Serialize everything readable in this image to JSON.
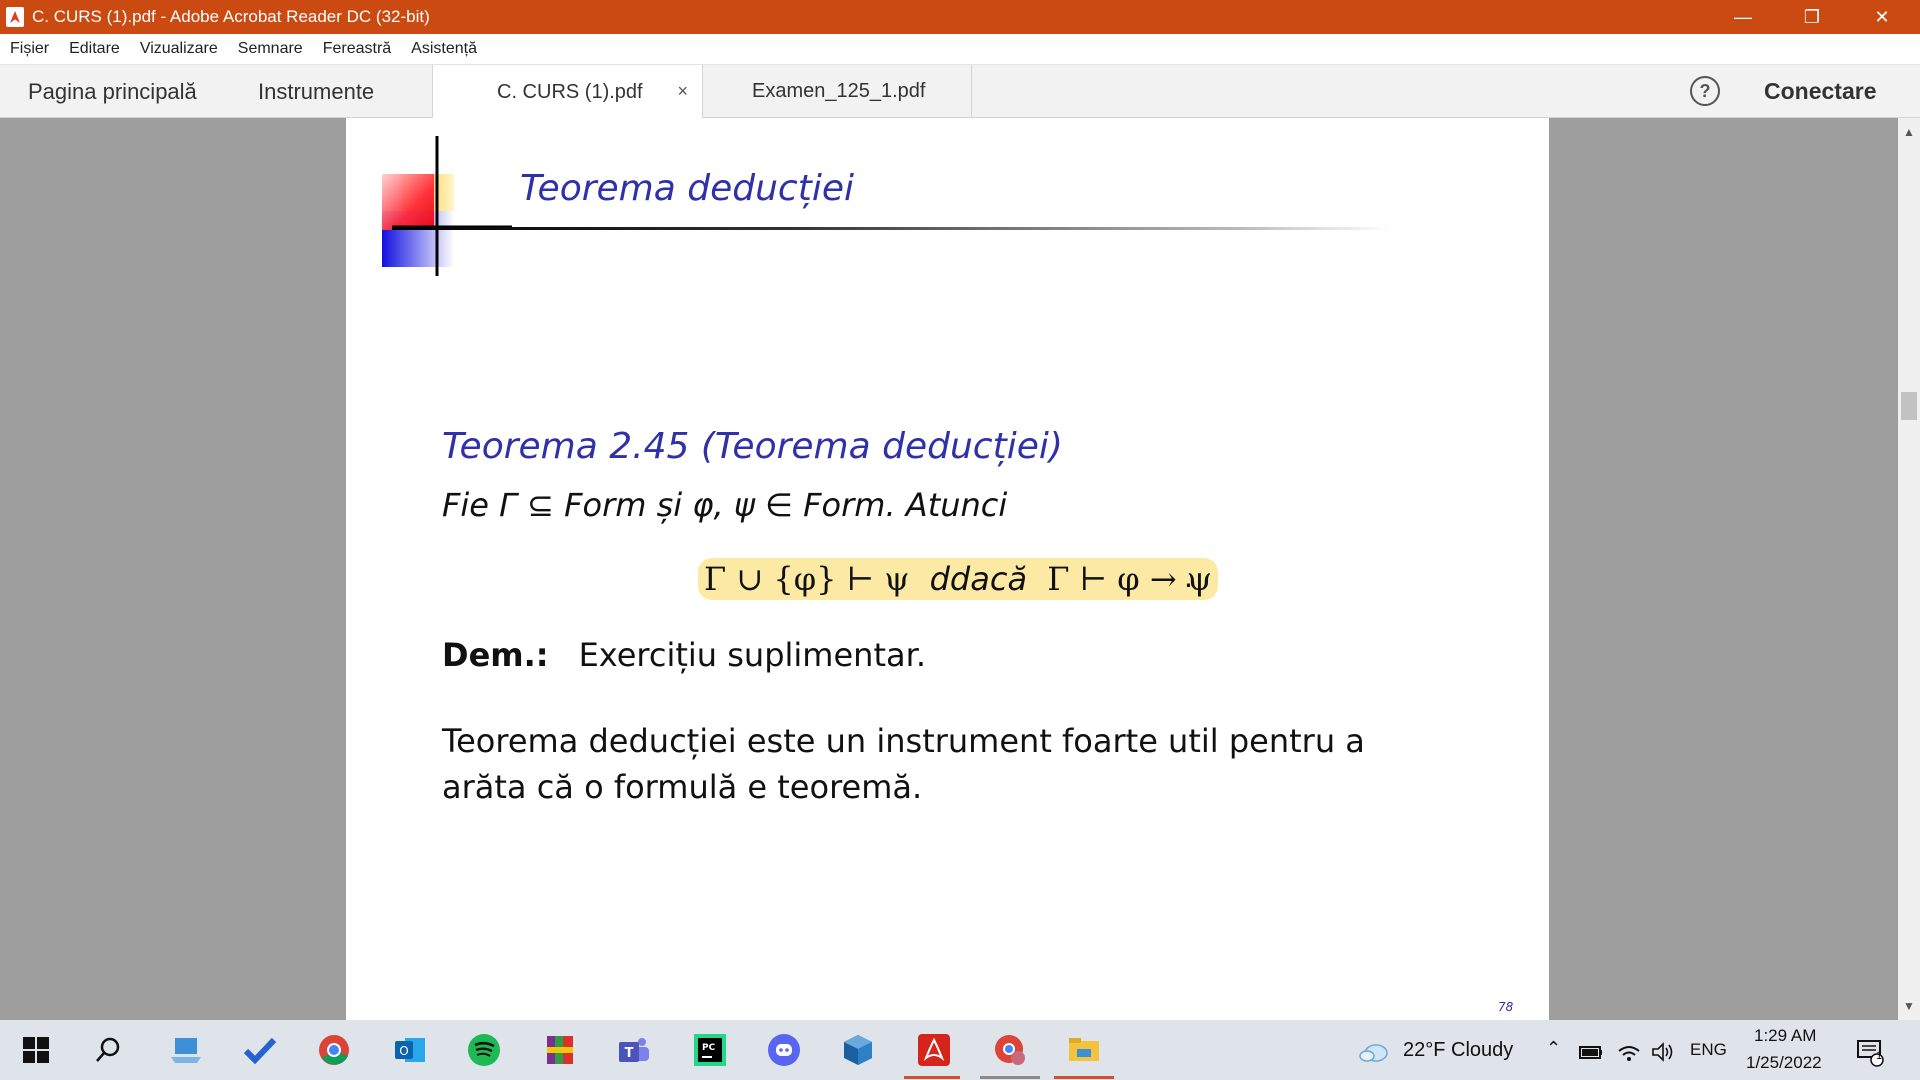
{
  "window": {
    "title": "C. CURS (1).pdf - Adobe Acrobat Reader DC (32-bit)"
  },
  "menu": [
    "Fișier",
    "Editare",
    "Vizualizare",
    "Semnare",
    "Fereastră",
    "Asistență"
  ],
  "tabs": {
    "home": "Pagina principală",
    "tools": "Instrumente",
    "documents": [
      {
        "label": "C. CURS (1).pdf",
        "active": true
      },
      {
        "label": "Examen_125_1.pdf",
        "active": false
      }
    ],
    "close_glyph": "×",
    "help_glyph": "?",
    "connect": "Conectare"
  },
  "slide": {
    "title": "Teorema deducției",
    "theorem_heading": "Teorema 2.45 (Teorema deducției)",
    "theorem_statement": "Fie Γ ⊆ Form și φ, ψ  ∈ Form.  Atunci",
    "formula_left": "Γ ∪ {φ} ⊢ ψ",
    "formula_iff": "ddacă",
    "formula_right": "Γ ⊢ φ → ψ",
    "formula_end": ".",
    "proof_label": "Dem.:",
    "proof_text": "Exercițiu suplimentar.",
    "paragraph": "Teorema deducției este un instrument foarte util pentru a arăta că o formulă e teoremă.",
    "page_number": "78"
  },
  "taskbar": {
    "apps": [
      "start-icon",
      "search-icon",
      "laptop-icon",
      "todo-icon",
      "chrome-icon",
      "outlook-icon",
      "spotify-icon",
      "winrar-icon",
      "teams-icon",
      "pycharm-icon",
      "discord-icon",
      "virtualbox-icon",
      "acrobat-icon",
      "chrome-profile-icon",
      "file-explorer-icon"
    ],
    "weather": "22°F  Cloudy",
    "lang": "ENG",
    "time": "1:29 AM",
    "date": "1/25/2022",
    "notifications": "1"
  },
  "colors": {
    "titlebar": "#ca4a12",
    "slide_blue": "#3030a8",
    "highlight": "#fbe9a4"
  }
}
